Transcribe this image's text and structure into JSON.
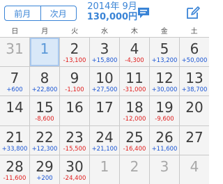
{
  "header": {
    "prev_month_label": "前月",
    "next_month_label": "次月",
    "year_month": "2014年 9月",
    "total_amount": "130,000円"
  },
  "weekdays": [
    "日",
    "月",
    "火",
    "水",
    "木",
    "金",
    "土"
  ],
  "calendar": [
    {
      "day": "31",
      "amount": "",
      "dim": true
    },
    {
      "day": "1",
      "amount": "",
      "selected": true
    },
    {
      "day": "2",
      "amount": "-13,100"
    },
    {
      "day": "3",
      "amount": "+15,800"
    },
    {
      "day": "4",
      "amount": "-4,300"
    },
    {
      "day": "5",
      "amount": "+13,200"
    },
    {
      "day": "6",
      "amount": "+50,000"
    },
    {
      "day": "7",
      "amount": "+600"
    },
    {
      "day": "8",
      "amount": "+22,800"
    },
    {
      "day": "9",
      "amount": "-1,100"
    },
    {
      "day": "10",
      "amount": "+27,500"
    },
    {
      "day": "11",
      "amount": "-31,000"
    },
    {
      "day": "12",
      "amount": "+30,000"
    },
    {
      "day": "13",
      "amount": "+38,700"
    },
    {
      "day": "14",
      "amount": ""
    },
    {
      "day": "15",
      "amount": "-8,600"
    },
    {
      "day": "16",
      "amount": ""
    },
    {
      "day": "17",
      "amount": ""
    },
    {
      "day": "18",
      "amount": "-12,000"
    },
    {
      "day": "19",
      "amount": "-9,600"
    },
    {
      "day": "20",
      "amount": ""
    },
    {
      "day": "21",
      "amount": "+33,800"
    },
    {
      "day": "22",
      "amount": "+12,300"
    },
    {
      "day": "23",
      "amount": "-15,500"
    },
    {
      "day": "24",
      "amount": "+21,100"
    },
    {
      "day": "25",
      "amount": "-16,400"
    },
    {
      "day": "26",
      "amount": "+11,600"
    },
    {
      "day": "27",
      "amount": ""
    },
    {
      "day": "28",
      "amount": "-11,600"
    },
    {
      "day": "29",
      "amount": "+200"
    },
    {
      "day": "30",
      "amount": "-24,400"
    },
    {
      "day": "1",
      "amount": "",
      "dim": true
    },
    {
      "day": "2",
      "amount": "",
      "dim": true
    },
    {
      "day": "3",
      "amount": "",
      "dim": true
    },
    {
      "day": "4",
      "amount": "",
      "dim": true
    }
  ],
  "colors": {
    "accent": "#3a84d6",
    "income": "#1a55d4",
    "expense": "#e01b1b",
    "selected_bg": "#d9e8f8"
  },
  "icons": {
    "comment": "chat-bubble-icon",
    "edit": "compose-icon"
  }
}
